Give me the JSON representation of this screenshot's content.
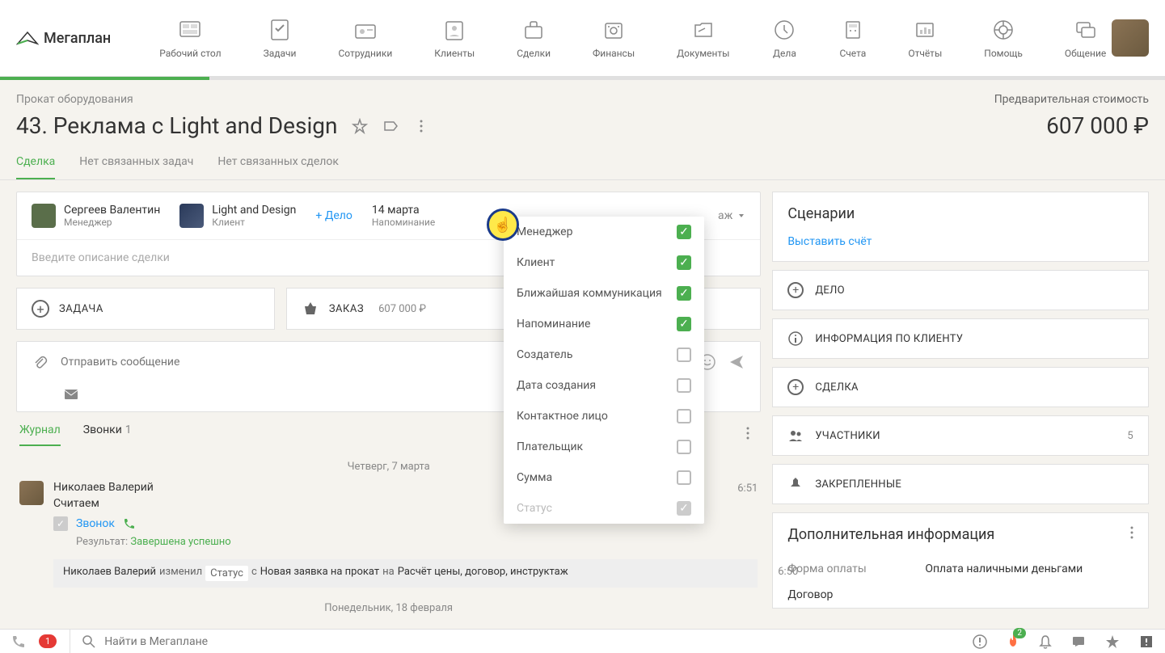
{
  "logo": "Мегаплан",
  "nav": {
    "desktop": "Рабочий стол",
    "tasks": "Задачи",
    "employees": "Сотрудники",
    "clients": "Клиенты",
    "deals": "Сделки",
    "finances": "Финансы",
    "documents": "Документы",
    "cases": "Дела",
    "bills": "Счета",
    "reports": "Отчёты",
    "help": "Помощь",
    "chat": "Общение"
  },
  "breadcrumb": "Прокат оборудования",
  "cost_label": "Предварительная стоимость",
  "title": "43. Реклама с Light and Design",
  "price": "607 000 ₽",
  "tabs": {
    "deal": "Сделка",
    "no_tasks": "Нет связанных задач",
    "no_deals": "Нет связанных сделок"
  },
  "manager": {
    "name": "Сергеев Валентин",
    "role": "Менеджер"
  },
  "client": {
    "name": "Light and Design",
    "role": "Клиент"
  },
  "add_case": "+ Дело",
  "reminder": {
    "date": "14 марта",
    "label": "Напоминание"
  },
  "status_partial": "аж",
  "desc_placeholder": "Введите описание сделки",
  "task_btn": "ЗАДАЧА",
  "order_btn": "ЗАКАЗ",
  "order_amount": "607 000 ₽",
  "msg_placeholder": "Отправить сообщение",
  "jtabs": {
    "journal": "Журнал",
    "calls": "Звонки",
    "calls_count": "1"
  },
  "dates": {
    "d1": "Четверг, 7 марта",
    "d2": "Понедельник, 18 февраля"
  },
  "entry1": {
    "name": "Николаев Валерий",
    "status": "Считаем",
    "time": "6:51",
    "call": "Звонок",
    "result_label": "Результат:",
    "result": "Завершена успешно"
  },
  "entry2": {
    "name": "Николаев Валерий",
    "verb": "изменил",
    "field": "Статус",
    "from_word": "с",
    "from": "Новая заявка на прокат",
    "to_word": "на",
    "to": "Расчёт цены, договор, инструктаж",
    "time": "6:50"
  },
  "dropdown": {
    "manager": "Менеджер",
    "client": "Клиент",
    "communication": "Ближайшая коммуникация",
    "reminder": "Напоминание",
    "creator": "Создатель",
    "created": "Дата создания",
    "contact": "Контактное лицо",
    "payer": "Плательщик",
    "sum": "Сумма",
    "status": "Статус"
  },
  "side": {
    "scenarios": "Сценарии",
    "invoice": "Выставить счёт",
    "case": "ДЕЛО",
    "client_info": "ИНФОРМАЦИЯ ПО КЛИЕНТУ",
    "deal": "СДЕЛКА",
    "participants": "УЧАСТНИКИ",
    "participants_count": "5",
    "pinned": "ЗАКРЕПЛЕННЫЕ",
    "addl": "Дополнительная информация",
    "pay_form_k": "Форма оплаты",
    "pay_form_v": "Оплата наличными деньгами",
    "contract": "Договор"
  },
  "bottom": {
    "phone_badge": "1",
    "search_placeholder": "Найти в Мегаплане",
    "fire_badge": "2"
  }
}
